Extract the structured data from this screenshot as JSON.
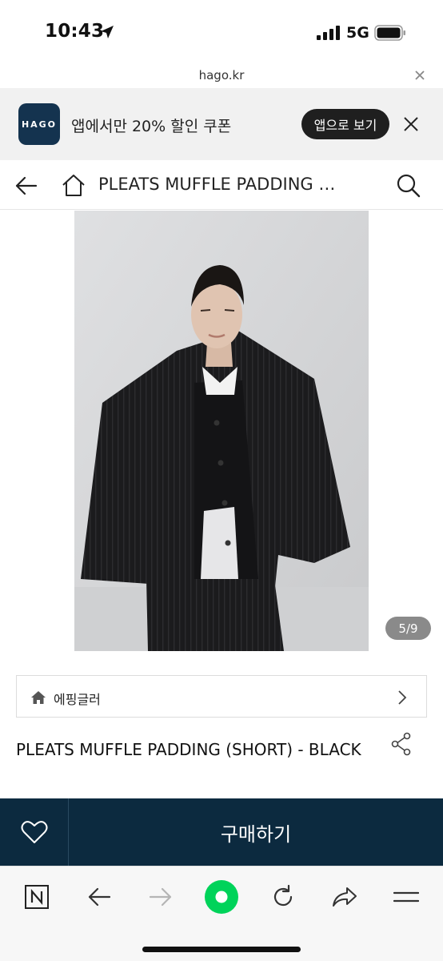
{
  "status_bar": {
    "time": "10:43",
    "network": "5G",
    "icons": [
      "location-arrow-icon",
      "signal-bars-icon",
      "battery-icon"
    ]
  },
  "url_bar": {
    "url": "hago.kr",
    "icons": [
      "close-icon"
    ]
  },
  "app_banner": {
    "logo_text": "HAGO",
    "message": "앱에서만 20% 할인 쿠폰",
    "open_button": "앱으로 보기",
    "icons": [
      "close-icon"
    ]
  },
  "header": {
    "title": "PLEATS MUFFLE PADDING …",
    "icons": [
      "back-arrow-icon",
      "home-icon",
      "search-icon"
    ]
  },
  "gallery": {
    "current": 5,
    "total": 9,
    "counter_text": "5/9"
  },
  "brand": {
    "name": "에핑글러",
    "icons": [
      "home-icon",
      "chevron-right-icon"
    ]
  },
  "product": {
    "title": "PLEATS MUFFLE PADDING (SHORT) - BLACK",
    "icons": [
      "share-icon"
    ]
  },
  "purchase_bar": {
    "buy_label": "구매하기",
    "icons": [
      "heart-icon"
    ]
  },
  "browser_toolbar": {
    "icons": [
      "naver-n-icon",
      "back-arrow-icon",
      "forward-arrow-icon",
      "green-circle-icon",
      "reload-icon",
      "share-arrow-icon",
      "menu-icon"
    ]
  },
  "colors": {
    "purchase_bar_bg": "#0c2a3f",
    "app_logo_bg": "#14334f",
    "green_button": "#00d35a"
  }
}
